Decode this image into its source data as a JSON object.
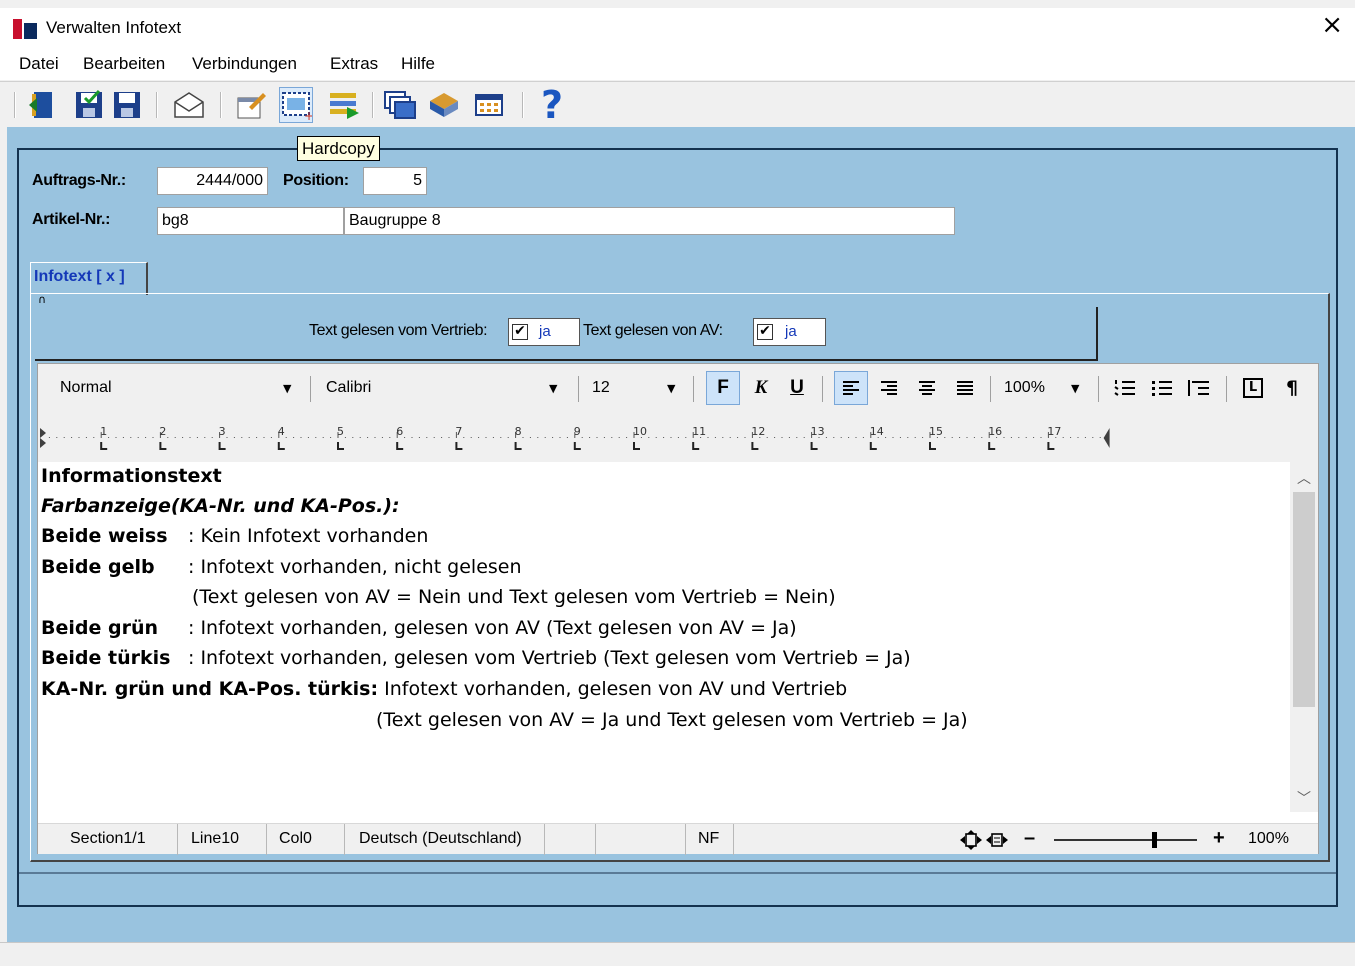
{
  "window": {
    "title": "Verwalten Infotext"
  },
  "menu": [
    "Datei",
    "Bearbeiten",
    "Verbindungen",
    "Extras",
    "Hilfe"
  ],
  "tooltip": "Hardcopy",
  "toolbar_icons": [
    "exit-door-icon",
    "save-all-icon",
    "save-icon",
    "mail-icon",
    "edit-window-icon",
    "hardcopy-icon",
    "list-export-icon",
    "windows-icon",
    "book-icon",
    "calendar-grid-icon",
    "help-icon"
  ],
  "toolbar_help_glyph": "?",
  "form": {
    "auftrag_label": "Auftrags-Nr.:",
    "auftrag_value": "2444/000",
    "position_label": "Position:",
    "position_value": "5",
    "artikel_label": "Artikel-Nr.:",
    "artikel_value": "bg8",
    "artikel_desc": "Baugruppe 8"
  },
  "tab": {
    "label": "Infotext [ x ]",
    "marker": "∩"
  },
  "flags": {
    "vertrieb_label": "Text gelesen vom Vertrieb:",
    "vertrieb_value": "ja",
    "vertrieb_checked": true,
    "av_label": "Text gelesen von AV:",
    "av_value": "ja",
    "av_checked": true
  },
  "editor_toolbar": {
    "style": "Normal",
    "font": "Calibri",
    "size": "12",
    "bold": "F",
    "italic": "K",
    "underline": "U",
    "zoom": "100%",
    "pilcrow": "¶",
    "frame_glyph": "L"
  },
  "ruler_numbers": [
    "1",
    "2",
    "3",
    "4",
    "5",
    "6",
    "7",
    "8",
    "9",
    "10",
    "11",
    "12",
    "13",
    "14",
    "15",
    "16",
    "17"
  ],
  "document": {
    "lines": [
      {
        "a": "Informationstext",
        "b": ""
      },
      {
        "a": "Farbanzeige(KA-Nr. und KA-Pos.):",
        "b": ""
      },
      {
        "a": "Beide weiss",
        "b": ": Kein Infotext vorhanden"
      },
      {
        "a": "Beide gelb",
        "b": ": Infotext vorhanden, nicht gelesen"
      },
      {
        "a": "",
        "b": "(Text gelesen von AV = Nein und Text gelesen vom Vertrieb = Nein)"
      },
      {
        "a": "Beide grün",
        "b": ": Infotext vorhanden, gelesen von AV (Text gelesen von AV = Ja)"
      },
      {
        "a": "Beide türkis",
        "b": ": Infotext vorhanden, gelesen vom Vertrieb (Text gelesen vom Vertrieb = Ja)"
      },
      {
        "a": "KA-Nr. grün und KA-Pos. türkis:",
        "b": " Infotext vorhanden, gelesen von AV und Vertrieb"
      },
      {
        "a": "",
        "b": "(Text gelesen von AV = Ja und Text gelesen vom Vertrieb = Ja)"
      }
    ]
  },
  "statusbar": {
    "section": "Section1/1",
    "line": "Line10",
    "col": "Col0",
    "language": "Deutsch (Deutschland)",
    "nf": "NF",
    "zoom_minus": "–",
    "zoom_plus": "+",
    "zoom": "100%",
    "zoom_level": 0.7
  },
  "colors": {
    "panel": "#99c3df",
    "tab_text": "#1438b8",
    "frame": "#14324f",
    "logo_red": "#c8102e",
    "logo_blue": "#0b2a5e"
  }
}
